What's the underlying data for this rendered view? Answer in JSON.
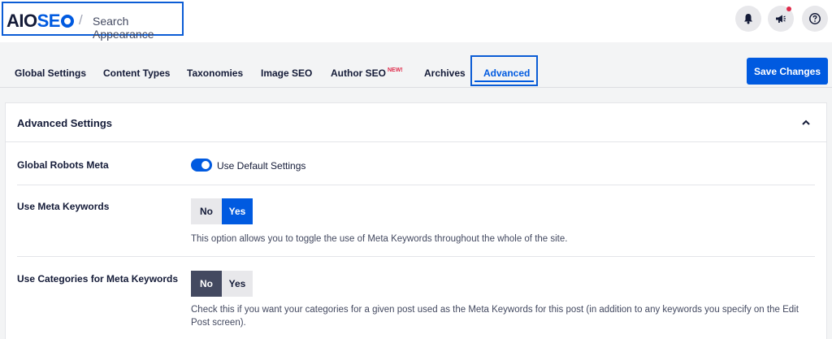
{
  "header": {
    "logo_main": "AIO",
    "logo_accent": "SE",
    "breadcrumb_separator": "/",
    "page_title": "Search Appearance",
    "icons": [
      "bell-icon",
      "megaphone-icon",
      "help-icon"
    ],
    "notification_dot_color": "#df2a4a"
  },
  "tabs": {
    "items": [
      {
        "label": "Global Settings"
      },
      {
        "label": "Content Types"
      },
      {
        "label": "Taxonomies"
      },
      {
        "label": "Image SEO"
      },
      {
        "label": "Author SEO",
        "badge": "NEW!"
      },
      {
        "label": "Archives"
      },
      {
        "label": "Advanced",
        "active": true
      }
    ],
    "save_label": "Save Changes"
  },
  "card": {
    "title": "Advanced Settings",
    "collapse_icon": "chevron-up-icon",
    "rows": {
      "global_robots": {
        "label": "Global Robots Meta",
        "toggle_on": true,
        "toggle_label": "Use Default Settings"
      },
      "meta_keywords": {
        "label": "Use Meta Keywords",
        "no_label": "No",
        "yes_label": "Yes",
        "selected": "Yes",
        "description": "This option allows you to toggle the use of Meta Keywords throughout the whole of the site."
      },
      "categories_keywords": {
        "label": "Use Categories for Meta Keywords",
        "no_label": "No",
        "yes_label": "Yes",
        "selected": "No",
        "description": "Check this if you want your categories for a given post used as the Meta Keywords for this post (in addition to any keywords you specify on the Edit Post screen)."
      }
    }
  },
  "colors": {
    "accent": "#005ae0",
    "highlight_box": "#0b5cd5",
    "dark_selected": "#434960"
  }
}
